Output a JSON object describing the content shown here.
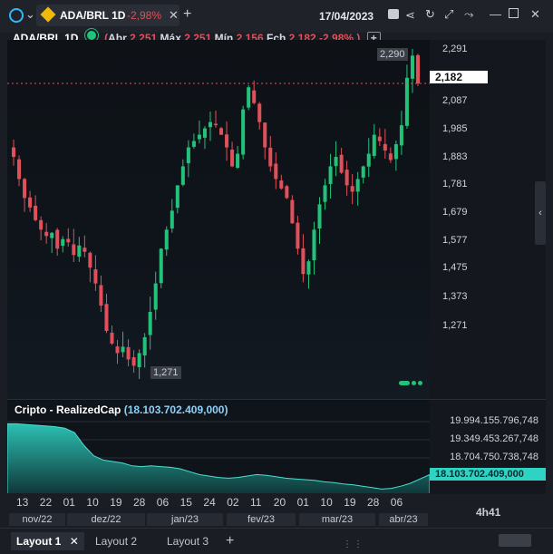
{
  "header": {
    "symbol": "ADA/BRL 1D",
    "change": "-2,98%",
    "date": "17/04/2023",
    "add_tab": "+"
  },
  "legend": {
    "symbol": "ADA/BRL 1D",
    "open_label": "Abr",
    "open": "2,251",
    "high_label": "Máx",
    "high": "2,251",
    "low_label": "Mín",
    "low": "2,156",
    "close_label": "Fch",
    "close": "2,182",
    "change": "-2,98%",
    "close_paren": ")",
    "add": "+"
  },
  "colors": {
    "up": "#22c27a",
    "down": "#e0505a",
    "accent": "#2fd3c4",
    "ind_fill": "#1f8f85"
  },
  "price_axis": {
    "ticks": [
      "2,291",
      "2,182",
      "2,087",
      "1,985",
      "1,883",
      "1,781",
      "1,679",
      "1,577",
      "1,475",
      "1,373",
      "1,271"
    ],
    "last_price": "2,182",
    "high_marker": "2,290",
    "low_marker": "1,271"
  },
  "indicator": {
    "title": "Cripto - RealizedCap",
    "value": "(18.103.702.409,000)",
    "ticks": [
      "19.994.155.796,748",
      "19.349.453.267,748",
      "18.704.750.738,748"
    ],
    "last_value": "18.103.702.409,000"
  },
  "x_axis": {
    "day_labels": [
      "13",
      "22",
      "01",
      "10",
      "19",
      "28",
      "06",
      "15",
      "24",
      "02",
      "11",
      "20",
      "01",
      "10",
      "19",
      "28",
      "06"
    ],
    "months": [
      "nov/22",
      "dez/22",
      "jan/23",
      "fev/23",
      "mar/23",
      "abr/23"
    ]
  },
  "footer": {
    "time_remaining": "4h41",
    "layouts": [
      "Layout 1",
      "Layout 2",
      "Layout 3"
    ],
    "add_layout": "+"
  },
  "icons": [
    "clock-icon",
    "chevron-down-icon",
    "binance-icon",
    "calendar-icon",
    "share-icon",
    "refresh-icon",
    "expand-icon",
    "drawing-icon",
    "minimize-icon",
    "maximize-icon",
    "close-icon",
    "visibility-icon",
    "right-arrow-icon",
    "more-icon"
  ]
}
